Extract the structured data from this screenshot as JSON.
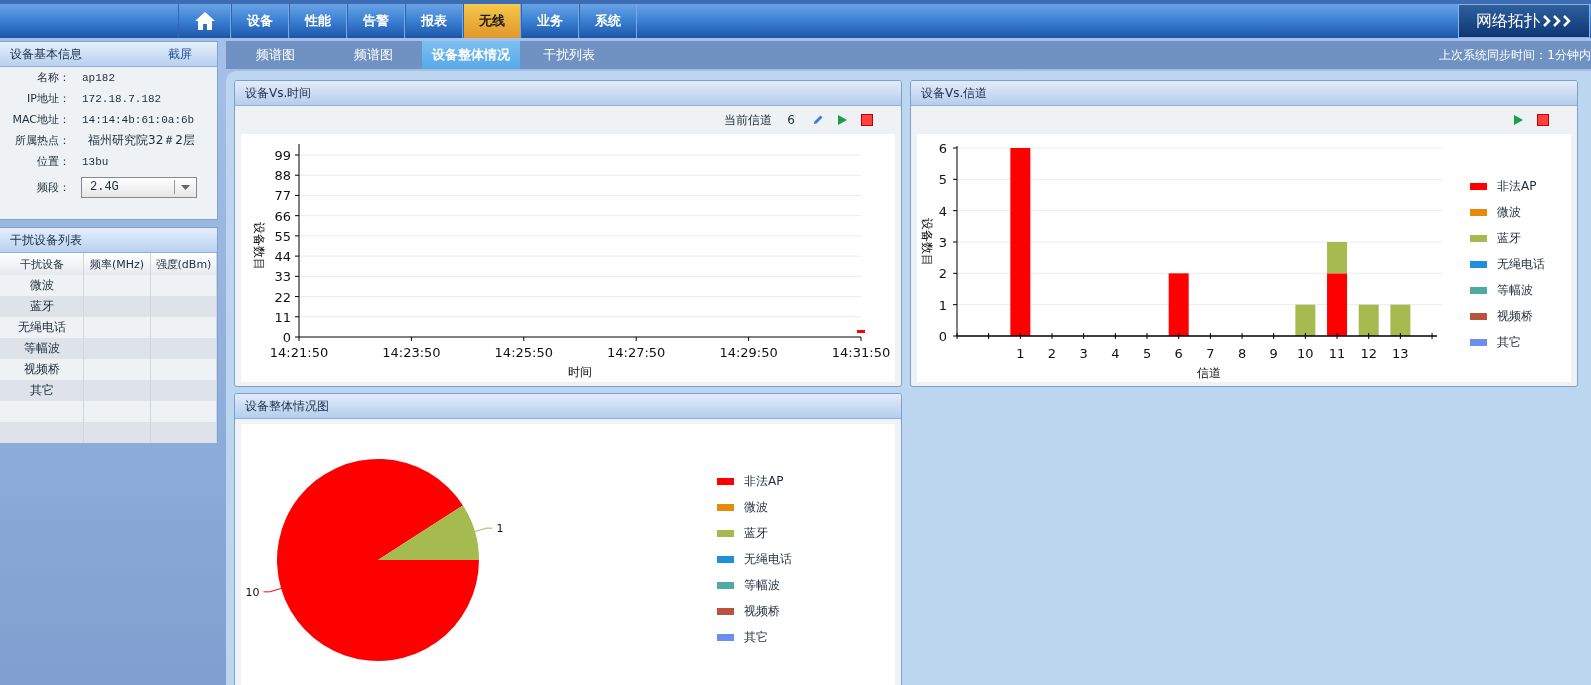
{
  "nav": {
    "tabs": [
      {
        "label": "设备",
        "selected": false
      },
      {
        "label": "性能",
        "selected": false
      },
      {
        "label": "告警",
        "selected": false
      },
      {
        "label": "报表",
        "selected": false
      },
      {
        "label": "无线",
        "selected": true
      },
      {
        "label": "业务",
        "selected": false
      },
      {
        "label": "系统",
        "selected": false
      }
    ],
    "topology_button": "网络拓扑"
  },
  "device_info": {
    "title": "设备基本信息",
    "screenshot_link": "截屏",
    "fields": [
      {
        "label": "名称：",
        "value": "ap182"
      },
      {
        "label": "IP地址：",
        "value": "172.18.7.182"
      },
      {
        "label": "MAC地址：",
        "value": "14:14:4b:61:0a:6b"
      },
      {
        "label": "所属热点：",
        "value": "福州研究院32＃2层"
      },
      {
        "label": "位置：",
        "value": "13bu"
      }
    ],
    "band": {
      "label": "频段：",
      "value": "2.4G"
    }
  },
  "interference_list": {
    "title": "干扰设备列表",
    "columns": [
      "干扰设备",
      "频率(MHz)",
      "强度(dBm)"
    ],
    "rows": [
      {
        "device": "微波"
      },
      {
        "device": "蓝牙"
      },
      {
        "device": "无绳电话"
      },
      {
        "device": "等幅波"
      },
      {
        "device": "视频桥"
      },
      {
        "device": "其它"
      }
    ]
  },
  "subtabs": [
    {
      "label": "频谱图",
      "selected": false
    },
    {
      "label": "频谱图",
      "selected": false
    },
    {
      "label": "设备整体情况",
      "selected": true
    },
    {
      "label": "干扰列表",
      "selected": false
    }
  ],
  "sync_status": "上次系统同步时间：1分钟内",
  "time_panel": {
    "title": "设备Vs.时间",
    "channel_label": "当前信道",
    "channel_value": "6",
    "chart_data": {
      "type": "line",
      "grid": true,
      "xlabel": "时间",
      "ylabel": "设备数目",
      "categories": [
        "14:21:50",
        "14:23:50",
        "14:25:50",
        "14:27:50",
        "14:29:50",
        "14:31:50"
      ],
      "ylim": [
        0,
        99
      ],
      "yticks": [
        0,
        11,
        22,
        33,
        44,
        55,
        66,
        77,
        88,
        99
      ],
      "series": [
        {
          "color": "#ff0000",
          "marker": "square",
          "values": [
            null,
            null,
            null,
            null,
            null,
            3
          ]
        }
      ]
    }
  },
  "channel_panel": {
    "title": "设备Vs.信道",
    "chart_data": {
      "type": "bar",
      "stacked": true,
      "grid": true,
      "legend": "right",
      "xlabel": "信道",
      "ylabel": "设备数目",
      "categories": [
        "1",
        "2",
        "3",
        "4",
        "5",
        "6",
        "7",
        "8",
        "9",
        "10",
        "11",
        "12",
        "13"
      ],
      "ylim": [
        0,
        6
      ],
      "yticks": [
        0,
        1,
        2,
        3,
        4,
        5,
        6
      ],
      "series": [
        {
          "name": "非法AP",
          "color": "#ff0000",
          "values": [
            6,
            0,
            0,
            0,
            0,
            2,
            0,
            0,
            0,
            0,
            2,
            0,
            0
          ]
        },
        {
          "name": "微波",
          "color": "#e8890c",
          "values": [
            0,
            0,
            0,
            0,
            0,
            0,
            0,
            0,
            0,
            0,
            0,
            0,
            0
          ]
        },
        {
          "name": "蓝牙",
          "color": "#a5bb4f",
          "values": [
            0,
            0,
            0,
            0,
            0,
            0,
            0,
            0,
            0,
            1,
            1,
            1,
            1
          ]
        },
        {
          "name": "无绳电话",
          "color": "#1f8fdc",
          "values": [
            0,
            0,
            0,
            0,
            0,
            0,
            0,
            0,
            0,
            0,
            0,
            0,
            0
          ]
        },
        {
          "name": "等幅波",
          "color": "#4eaaa2",
          "values": [
            0,
            0,
            0,
            0,
            0,
            0,
            0,
            0,
            0,
            0,
            0,
            0,
            0
          ]
        },
        {
          "name": "视频桥",
          "color": "#b8533e",
          "values": [
            0,
            0,
            0,
            0,
            0,
            0,
            0,
            0,
            0,
            0,
            0,
            0,
            0
          ]
        },
        {
          "name": "其它",
          "color": "#6a8ff0",
          "values": [
            0,
            0,
            0,
            0,
            0,
            0,
            0,
            0,
            0,
            0,
            0,
            0,
            0
          ]
        }
      ]
    }
  },
  "overview_panel": {
    "title": "设备整体情况图",
    "chart_data": {
      "type": "pie",
      "data_labels": true,
      "legend": "right",
      "categories": [
        "非法AP",
        "微波",
        "蓝牙",
        "无绳电话",
        "等幅波",
        "视频桥",
        "其它"
      ],
      "colors": [
        "#ff0000",
        "#e8890c",
        "#a5bb4f",
        "#1f8fdc",
        "#4eaaa2",
        "#b8533e",
        "#6a8ff0"
      ],
      "values": [
        10,
        0,
        1,
        0,
        0,
        0,
        0
      ]
    }
  }
}
